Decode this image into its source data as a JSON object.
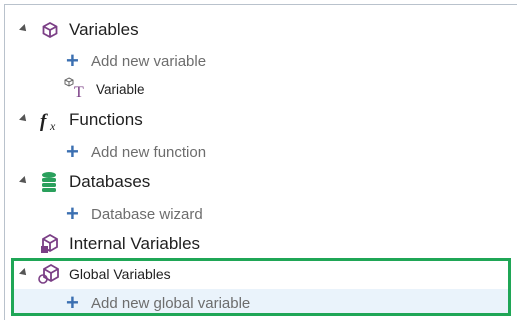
{
  "tree": {
    "variables": {
      "label": "Variables",
      "add_label": "Add new variable",
      "child_label": "Variable"
    },
    "functions": {
      "label": "Functions",
      "add_label": "Add new function"
    },
    "databases": {
      "label": "Databases",
      "add_label": "Database wizard"
    },
    "internal": {
      "label": "Internal Variables"
    },
    "global": {
      "label": "Global Variables",
      "add_label": "Add new global variable"
    }
  },
  "icons": {
    "variables": "cube-icon",
    "functions": "function-fx-icon",
    "databases": "database-icon",
    "internal": "internal-variables-icon",
    "global": "global-variables-icon",
    "add": "plus-icon",
    "variable_item": "text-variable-icon"
  },
  "colors": {
    "accent_purple": "#7b3f86",
    "add_blue": "#3b6fb1",
    "db_green": "#2aa05c",
    "highlight_green": "#1fa656",
    "selection_bg": "#eaf3fb"
  }
}
